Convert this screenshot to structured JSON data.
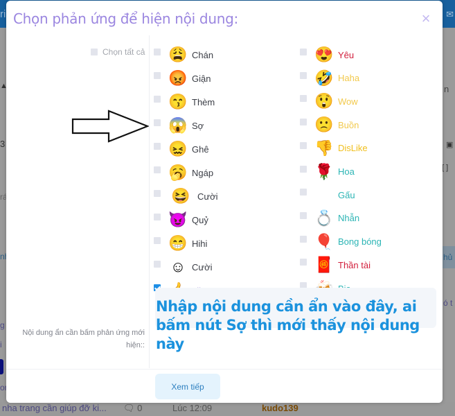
{
  "background": {
    "topbar_left": "ri",
    "topbar_right": "✉",
    "left_fragments": [
      "▲",
      "3",
      "rá",
      "nh",
      "g",
      "i",
      "on"
    ],
    "right_fragments": [
      "n",
      "▣",
      "[ ]",
      "hủ",
      "ó t"
    ],
    "bottom_row": {
      "topic": "nha trang cần giúp đỡ ki...",
      "replies": "0",
      "time": "Lúc 12:09",
      "user": "kudo139"
    }
  },
  "modal": {
    "title": "Chọn phản ứng để hiện nội dung:",
    "close_label": "×",
    "select_all_label": "Chọn tất cả",
    "left_column": [
      {
        "label": "Chán",
        "icon": "weary-face",
        "glyph": "😩",
        "color": "#3a3d45",
        "checked": false
      },
      {
        "label": "Giận",
        "icon": "angry-face",
        "glyph": "😡",
        "color": "#3a3d45",
        "checked": false
      },
      {
        "label": "Thèm",
        "icon": "kissing-face",
        "glyph": "😙",
        "color": "#3a3d45",
        "checked": false
      },
      {
        "label": "Sợ",
        "icon": "scared-face",
        "glyph": "😱",
        "color": "#3a3d45",
        "checked": false
      },
      {
        "label": "Ghê",
        "icon": "disgusted-face",
        "glyph": "😖",
        "color": "#3a3d45",
        "checked": false
      },
      {
        "label": "Ngáp",
        "icon": "yawning-face",
        "glyph": "🥱",
        "color": "#3a3d45",
        "checked": false
      },
      {
        "label": "Cười",
        "icon": "laughing-pointing-face",
        "glyph": "😆",
        "color": "#3a3d45",
        "checked": false
      },
      {
        "label": "Quỷ",
        "icon": "devil-face",
        "glyph": "😈",
        "color": "#3a3d45",
        "checked": false
      },
      {
        "label": "Hihi",
        "icon": "grinning-face",
        "glyph": "😁",
        "color": "#3a3d45",
        "checked": false
      },
      {
        "label": "Cười",
        "icon": "smiley-face",
        "glyph": "☺",
        "color": "#3a3d45",
        "checked": false
      },
      {
        "label": "Like",
        "icon": "thumbs-up-face",
        "glyph": "👍",
        "color": "#a28ee0",
        "checked": true
      }
    ],
    "right_column": [
      {
        "label": "Yêu",
        "icon": "heart-eyes-face",
        "glyph": "😍",
        "color": "#d21f3c",
        "checked": false
      },
      {
        "label": "Haha",
        "icon": "rofl-face",
        "glyph": "🤣",
        "color": "#f2c94c",
        "checked": false
      },
      {
        "label": "Wow",
        "icon": "astonished-face",
        "glyph": "😲",
        "color": "#f2c94c",
        "checked": false
      },
      {
        "label": "Buồn",
        "icon": "frowning-face",
        "glyph": "🙁",
        "color": "#f2c94c",
        "checked": false
      },
      {
        "label": "DisLike",
        "icon": "thumbs-down-icon",
        "glyph": "👎",
        "color": "#f0bf1d",
        "checked": false
      },
      {
        "label": "Hoa",
        "icon": "rose-icon",
        "glyph": "🌹",
        "color": "#2cb5b5",
        "checked": false
      },
      {
        "label": "Gấu",
        "icon": "",
        "glyph": "",
        "color": "#2cb5b5",
        "checked": false
      },
      {
        "label": "Nhẫn",
        "icon": "ring-icon",
        "glyph": "💍",
        "color": "#2cb5b5",
        "checked": false
      },
      {
        "label": "Bong bóng",
        "icon": "balloons-icon",
        "glyph": "🎈",
        "color": "#2cb5b5",
        "checked": false
      },
      {
        "label": "Thần tài",
        "icon": "god-of-wealth-icon",
        "glyph": "🧧",
        "color": "#d21f3c",
        "checked": false
      },
      {
        "label": "Bia",
        "icon": "beer-icon",
        "glyph": "🍻",
        "color": "#2cb5b5",
        "checked": false
      }
    ],
    "hidden_content_label": "Nội dung ẩn cần bấm phản ứng mới hiện::",
    "hidden_content_text": "Nhập nội dung cần ẩn vào đây, ai bấm nút Sợ thì mới thấy nội dung này",
    "next_button_label": "Xem tiếp"
  },
  "annotation": {
    "arrow_target": "Sợ"
  }
}
